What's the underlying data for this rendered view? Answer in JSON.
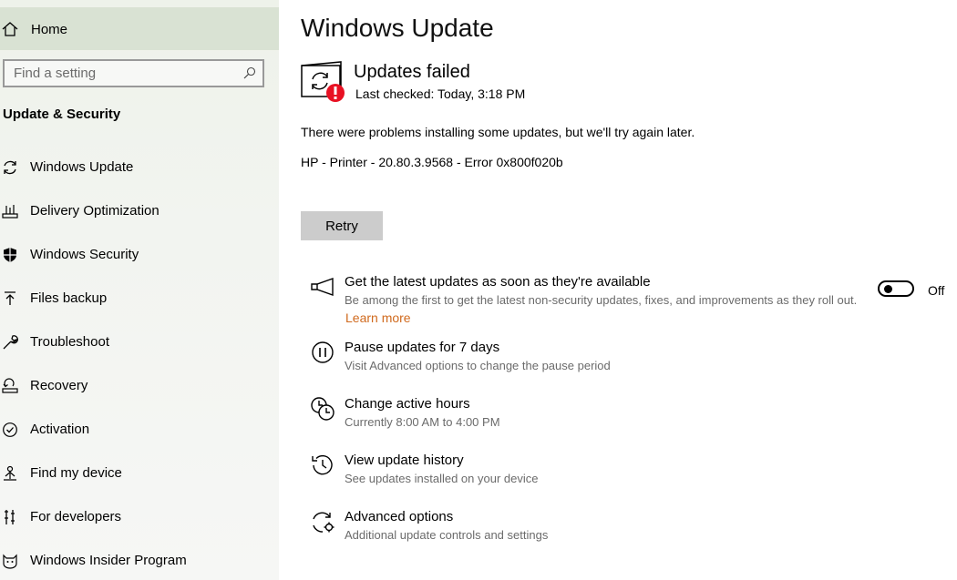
{
  "sidebar": {
    "home_label": "Home",
    "search_placeholder": "Find a setting",
    "section_title": "Update & Security",
    "items": [
      {
        "label": "Windows Update",
        "icon": "sync-icon"
      },
      {
        "label": "Delivery Optimization",
        "icon": "delivery-optimization-icon"
      },
      {
        "label": "Windows Security",
        "icon": "shield-icon"
      },
      {
        "label": "Files backup",
        "icon": "upload-arrow-icon"
      },
      {
        "label": "Troubleshoot",
        "icon": "wrench-icon"
      },
      {
        "label": "Recovery",
        "icon": "recovery-icon"
      },
      {
        "label": "Activation",
        "icon": "check-circle-icon"
      },
      {
        "label": "Find my device",
        "icon": "person-location-icon"
      },
      {
        "label": "For developers",
        "icon": "developer-tools-icon"
      },
      {
        "label": "Windows Insider Program",
        "icon": "insider-cat-icon"
      }
    ]
  },
  "main": {
    "title": "Windows Update",
    "status_heading": "Updates failed",
    "last_checked": "Last checked: Today, 3:18 PM",
    "problem_text": "There were problems installing some updates, but we'll try again later.",
    "error_line": "HP - Printer - 20.80.3.9568 - Error 0x800f020b",
    "retry_label": "Retry",
    "options": [
      {
        "title": "Get the latest updates as soon as they're available",
        "desc": "Be among the first to get the latest non-security updates, fixes, and improvements as they roll out.",
        "link": "Learn more",
        "toggle_state": "Off",
        "icon": "megaphone-icon"
      },
      {
        "title": "Pause updates for 7 days",
        "desc": "Visit Advanced options to change the pause period",
        "icon": "pause-icon"
      },
      {
        "title": "Change active hours",
        "desc": "Currently 8:00 AM to 4:00 PM",
        "icon": "active-hours-clock-icon"
      },
      {
        "title": "View update history",
        "desc": "See updates installed on your device",
        "icon": "history-icon"
      },
      {
        "title": "Advanced options",
        "desc": "Additional update controls and settings",
        "icon": "advanced-sync-gear-icon"
      }
    ]
  },
  "colors": {
    "accent_link": "#d06a1e",
    "error_badge": "#e81123",
    "home_highlight": "#d9e2d3",
    "retry_button": "#cccccc"
  }
}
